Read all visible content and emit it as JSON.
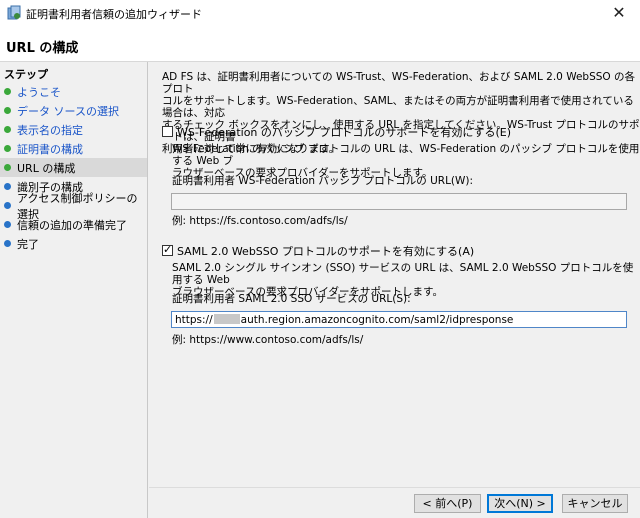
{
  "window": {
    "title": "証明書利用者信頼の追加ウィザード",
    "close": "✕"
  },
  "header": {
    "title": "URL の構成"
  },
  "steps": {
    "label": "ステップ",
    "items": [
      {
        "label": "ようこそ",
        "state": "done"
      },
      {
        "label": "データ ソースの選択",
        "state": "done"
      },
      {
        "label": "表示名の指定",
        "state": "done"
      },
      {
        "label": "証明書の構成",
        "state": "done"
      },
      {
        "label": "URL の構成",
        "state": "current"
      },
      {
        "label": "識別子の構成",
        "state": "pending"
      },
      {
        "label": "アクセス制御ポリシーの選択",
        "state": "pending"
      },
      {
        "label": "信頼の追加の準備完了",
        "state": "pending"
      },
      {
        "label": "完了",
        "state": "pending"
      }
    ]
  },
  "main": {
    "intro": [
      "AD FS は、証明書利用者についての WS-Trust、WS-Federation、および SAML 2.0 WebSSO の各プロト",
      "コルをサポートします。WS-Federation、SAML、またはその両方が証明書利用者で使用されている場合は、対応",
      "するチェック ボックスをオンにし、使用する URL を指定してください。WS-Trust プロトコルのサポートは、証明書",
      "利用者に対して常に有効になります。"
    ],
    "wsfed": {
      "checkbox_label": "WS-Federation のパッシブ プロトコルのサポートを有効にする(E)",
      "checked": false,
      "desc": [
        "WS-Federation のパッシブ プロトコルの URL は、WS-Federation のパッシブ プロトコルを使用する Web ブ",
        "ラウザーベースの要求プロバイダーをサポートします。"
      ],
      "field_label": "証明書利用者 WS-Federation パッシブ プロトコルの URL(W):",
      "value": "",
      "example": "例: https://fs.contoso.com/adfs/ls/"
    },
    "saml": {
      "checkbox_label": "SAML 2.0 WebSSO プロトコルのサポートを有効にする(A)",
      "checked": true,
      "desc": [
        "SAML 2.0 シングル サインオン (SSO) サービスの URL は、SAML 2.0 WebSSO プロトコルを使用する Web",
        "ブラウザーベースの要求プロバイダーをサポートします。"
      ],
      "field_label": "証明書利用者 SAML 2.0 SSO サービスの URL(S):",
      "value_prefix": "https://",
      "value_suffix": "auth.region.amazoncognito.com/saml2/idpresponse",
      "example": "例: https://www.contoso.com/adfs/ls/"
    }
  },
  "buttons": {
    "back": "< 前へ(P)",
    "next": "次へ(N) >",
    "cancel": "キャンセル"
  },
  "colors": {
    "done_dot": "#3aa83a",
    "pending_dot": "#2873c8",
    "link": "#1a55c8"
  }
}
